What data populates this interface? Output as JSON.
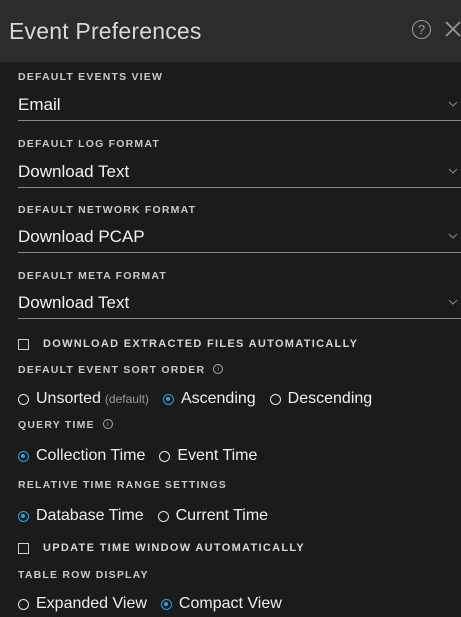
{
  "header": {
    "title": "Event Preferences"
  },
  "default_events_view": {
    "label": "DEFAULT EVENTS VIEW",
    "value": "Email"
  },
  "default_log_format": {
    "label": "DEFAULT LOG FORMAT",
    "value": "Download Text"
  },
  "default_network_format": {
    "label": "DEFAULT NETWORK FORMAT",
    "value": "Download PCAP"
  },
  "default_meta_format": {
    "label": "DEFAULT META FORMAT",
    "value": "Download Text"
  },
  "download_extracted": {
    "label": "DOWNLOAD EXTRACTED FILES AUTOMATICALLY",
    "checked": false
  },
  "sort_order": {
    "label": "DEFAULT EVENT SORT ORDER",
    "options": [
      {
        "label": "Unsorted",
        "sub": "(default)",
        "selected": false
      },
      {
        "label": "Ascending",
        "selected": true
      },
      {
        "label": "Descending",
        "selected": false
      }
    ]
  },
  "query_time": {
    "label": "QUERY TIME",
    "options": [
      {
        "label": "Collection Time",
        "selected": true
      },
      {
        "label": "Event Time",
        "selected": false
      }
    ]
  },
  "relative_time": {
    "label": "RELATIVE TIME RANGE SETTINGS",
    "options": [
      {
        "label": "Database Time",
        "selected": true
      },
      {
        "label": "Current Time",
        "selected": false
      }
    ]
  },
  "update_window": {
    "label": "UPDATE TIME WINDOW AUTOMATICALLY",
    "checked": false
  },
  "table_row_display": {
    "label": "TABLE ROW DISPLAY",
    "options": [
      {
        "label": "Expanded View",
        "selected": false
      },
      {
        "label": "Compact View",
        "selected": true
      }
    ]
  },
  "colors": {
    "accent": "#2aa3e6",
    "header_bg": "#2c2c2c",
    "panel_bg": "#1b1b1b"
  },
  "icons": {
    "help": "question-circle-icon",
    "close": "close-icon",
    "info": "info-circle-icon",
    "chevron": "chevron-down-icon"
  }
}
